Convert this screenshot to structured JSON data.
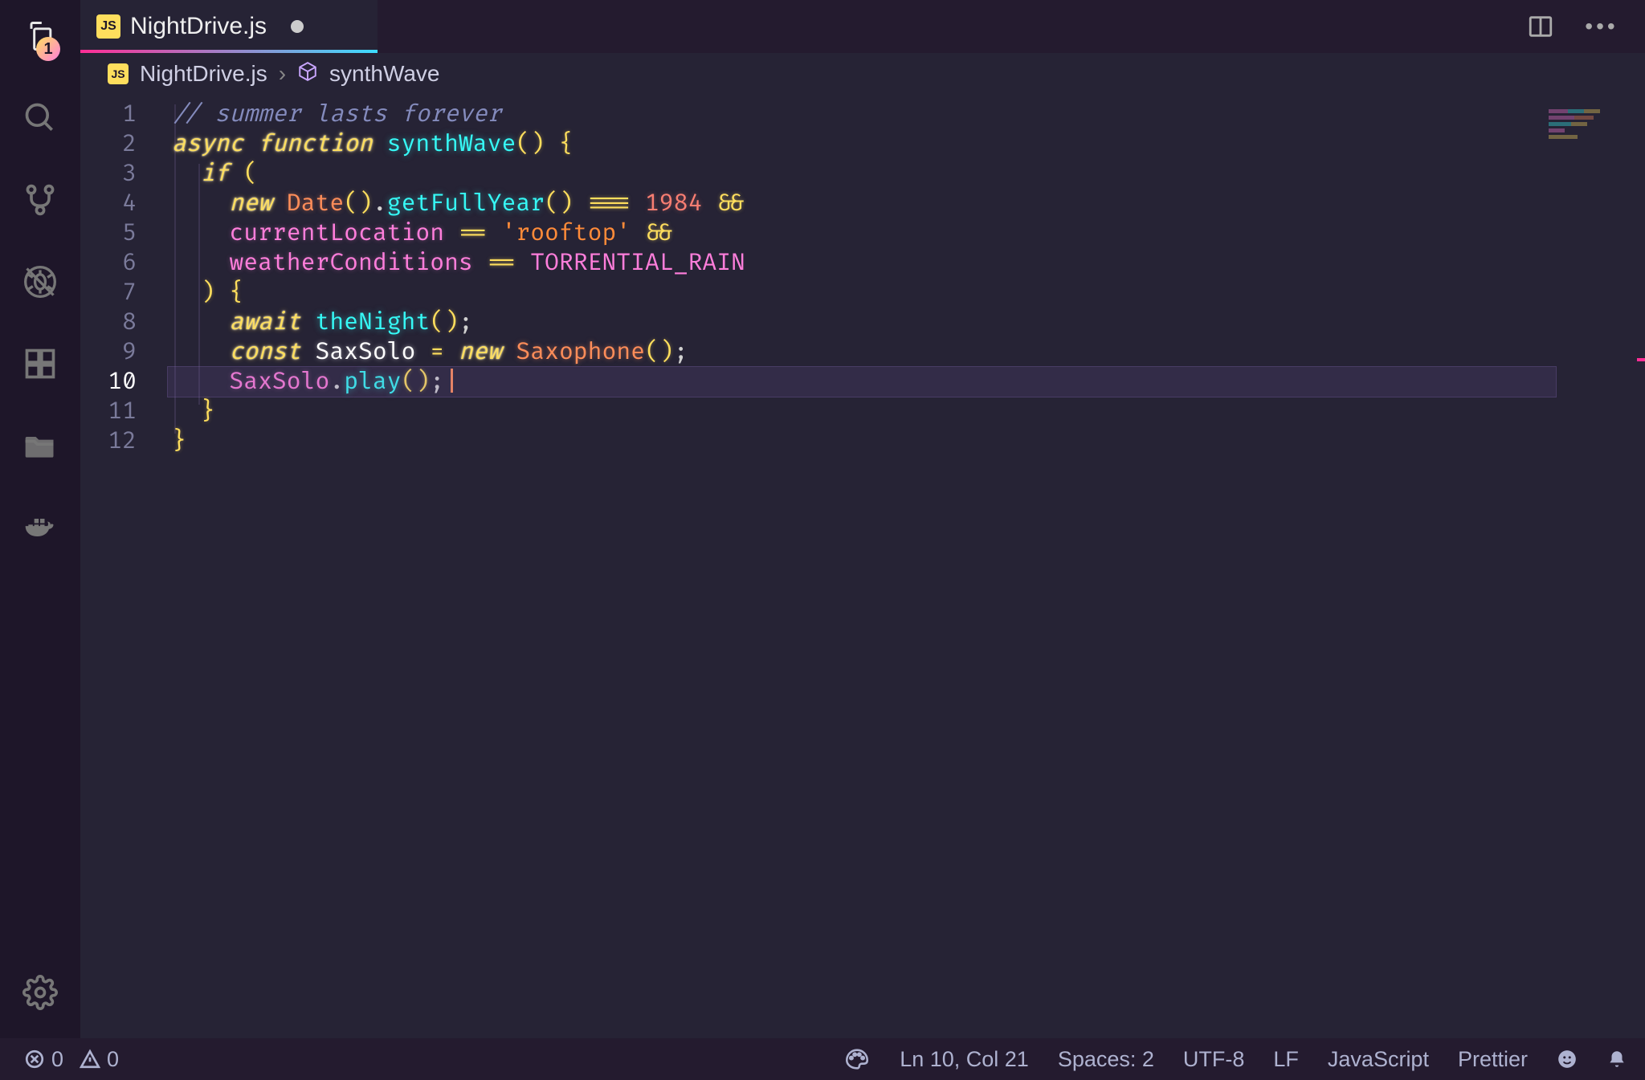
{
  "activity_bar": {
    "explorer_badge": "1"
  },
  "tab": {
    "badge": "JS",
    "label": "NightDrive.js"
  },
  "breadcrumbs": {
    "badge": "JS",
    "file": "NightDrive.js",
    "symbol": "synthWave"
  },
  "editor": {
    "line_numbers": [
      "1",
      "2",
      "3",
      "4",
      "5",
      "6",
      "7",
      "8",
      "9",
      "10",
      "11",
      "12"
    ],
    "cursor_line": 10,
    "code": {
      "l1_comment": "// summer lasts forever",
      "l2_async": "async",
      "l2_function": "function",
      "l2_name": "synthWave",
      "l2_parens": "()",
      "l2_brace": "{",
      "l3_if": "if",
      "l3_open": "(",
      "l4_new": "new",
      "l4_date": "Date",
      "l4_date_call": "()",
      "l4_dot": ".",
      "l4_getfullyear": "getFullYear",
      "l4_call": "()",
      "l4_eq": "===",
      "l4_year": "1984",
      "l4_and": "&&",
      "l5_currentLocation": "currentLocation",
      "l5_eq": "==",
      "l5_str": "'rooftop'",
      "l5_and": "&&",
      "l6_weather": "weatherConditions",
      "l6_eq": "==",
      "l6_rain": "TORRENTIAL_RAIN",
      "l7_close": ")",
      "l7_brace": "{",
      "l8_await": "await",
      "l8_theNight": "theNight",
      "l8_call": "()",
      "l8_semi": ";",
      "l9_const": "const",
      "l9_saxsolo": "SaxSolo",
      "l9_assign": "=",
      "l9_new": "new",
      "l9_sax": "Saxophone",
      "l9_call": "()",
      "l9_semi": ";",
      "l10_saxsolo": "SaxSolo",
      "l10_dot": ".",
      "l10_play": "play",
      "l10_call": "()",
      "l10_semi": ";",
      "l11_brace": "}",
      "l12_brace": "}"
    }
  },
  "statusbar": {
    "errors": "0",
    "warnings": "0",
    "position": "Ln 10, Col 21",
    "spaces": "Spaces: 2",
    "encoding": "UTF-8",
    "eol": "LF",
    "language": "JavaScript",
    "formatter": "Prettier"
  }
}
